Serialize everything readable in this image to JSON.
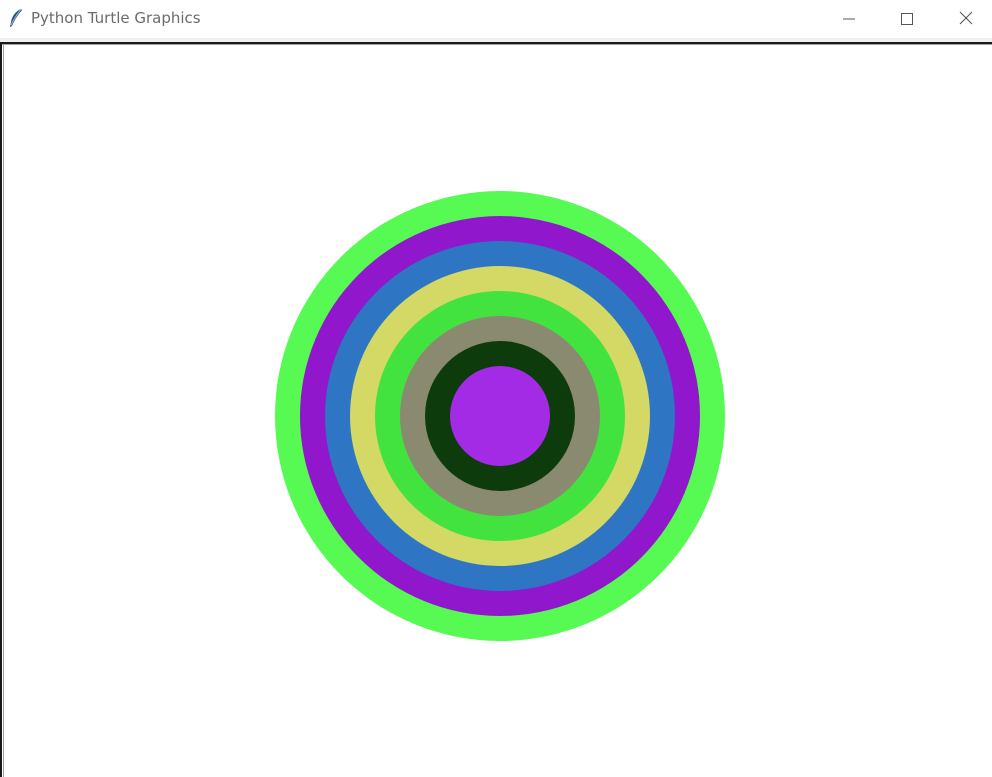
{
  "window": {
    "title": "Python Turtle Graphics",
    "controls": {
      "minimize_icon": "minimize-icon",
      "maximize_icon": "maximize-icon",
      "close_icon": "close-icon"
    },
    "app_icon": "feather-icon"
  },
  "canvas": {
    "background": "#ffffff",
    "rings": [
      {
        "name": "ring-1-outer",
        "color": "#57fa53"
      },
      {
        "name": "ring-2",
        "color": "#9017cb"
      },
      {
        "name": "ring-3",
        "color": "#2e75c3"
      },
      {
        "name": "ring-4",
        "color": "#d3d964"
      },
      {
        "name": "ring-5",
        "color": "#43e33f"
      },
      {
        "name": "ring-6",
        "color": "#8a8a71"
      },
      {
        "name": "ring-7",
        "color": "#0e3b0c"
      },
      {
        "name": "ring-8-center",
        "color": "#a32be6"
      }
    ]
  }
}
